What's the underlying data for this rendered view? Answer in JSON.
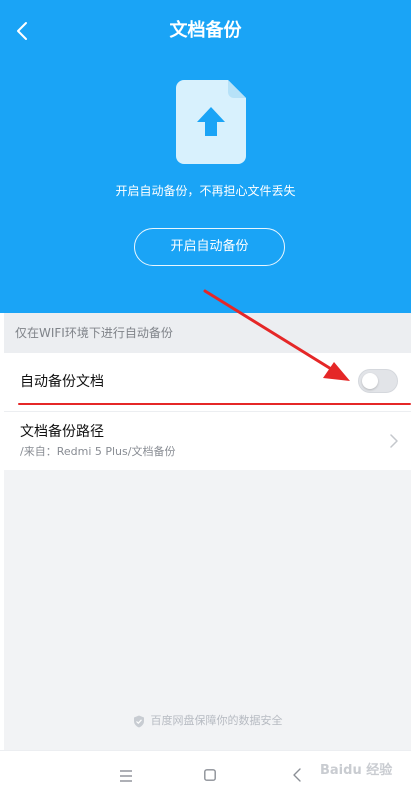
{
  "header": {
    "title": "文档备份",
    "back_icon": "chevron-left-icon"
  },
  "hero": {
    "icon": "document-upload-icon",
    "tagline": "开启自动备份，不再担心文件丢失",
    "enable_button_label": "开启自动备份"
  },
  "settings": {
    "hint": "仅在WIFI环境下进行自动备份",
    "auto_backup": {
      "label": "自动备份文档",
      "enabled": false
    },
    "backup_path": {
      "label": "文档备份路径",
      "value": "/来自：Redmi 5 Plus/文档备份",
      "chevron_icon": "chevron-right-icon"
    }
  },
  "footer": {
    "security_text": "百度网盘保障你的数据安全",
    "security_icon": "shield-icon"
  },
  "navbar": {
    "items": [
      "menu-icon",
      "home-icon",
      "back-icon"
    ]
  },
  "watermark": {
    "text": "Baidu 经验"
  },
  "colors": {
    "brand_blue": "#1aa4f6",
    "annotation_red": "#e52727"
  }
}
